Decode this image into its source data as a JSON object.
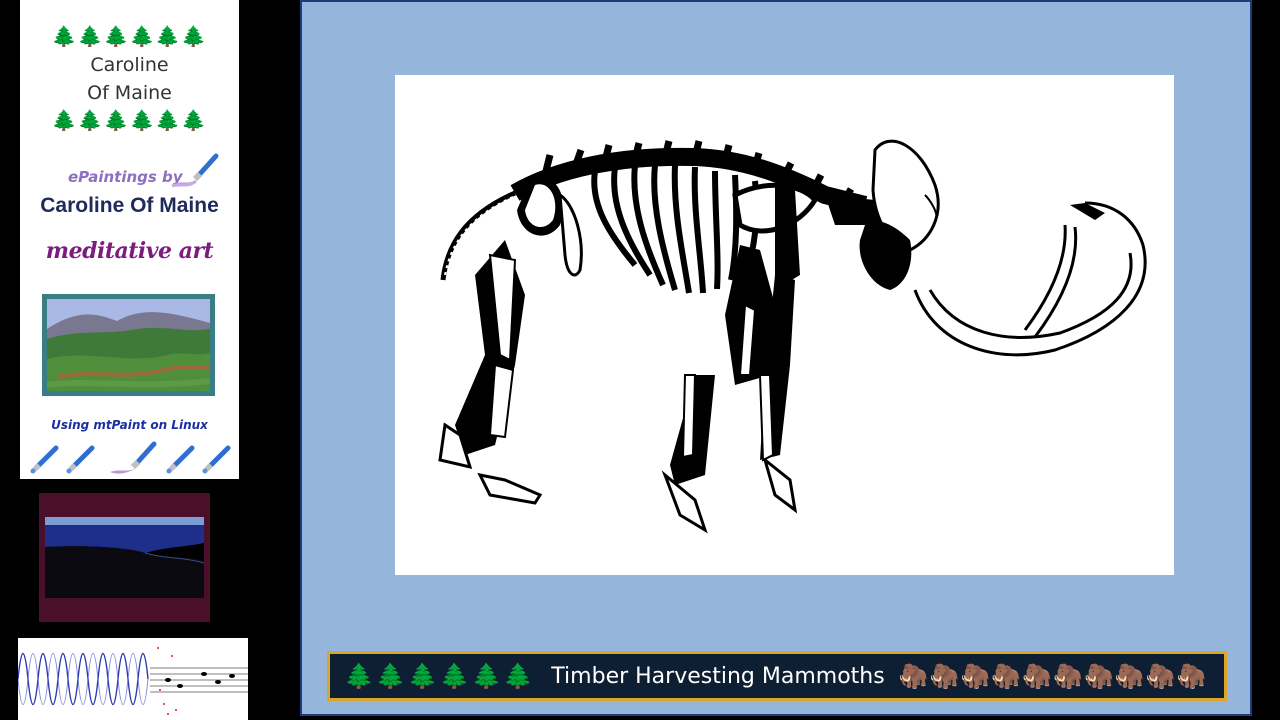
{
  "sidebar": {
    "tree_row": "🌲🌲🌲🌲🌲🌲",
    "name_line_1": "Caroline",
    "name_line_2": "Of Maine",
    "epaintings_label": "ePaintings by",
    "brand_name": "Caroline Of Maine",
    "tagline": "meditative art",
    "using_label": "Using mtPaint on Linux",
    "brush_icon": "paintbrush-icon"
  },
  "caption": {
    "trees": "🌲🌲🌲🌲🌲🌲",
    "title": "Timber Harvesting Mammoths",
    "mammoths": "🦣🦣🦣🦣🦣🦣🦣🦣🦣🦣"
  },
  "colors": {
    "frame_background": "#96b5da",
    "caption_background": "#0f1f33",
    "caption_border": "#d9a62a",
    "brand_color": "#1e2a5a",
    "tagline_color": "#7b1d7e"
  }
}
